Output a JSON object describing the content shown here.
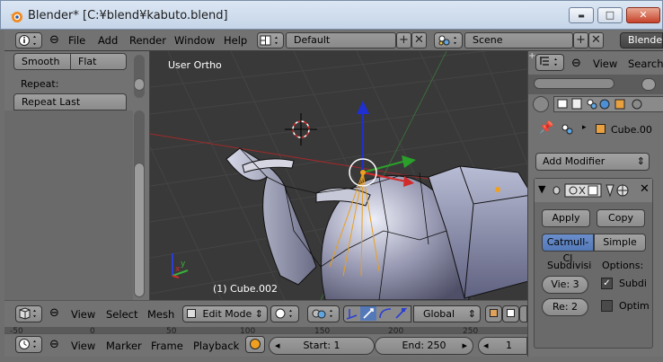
{
  "window": {
    "title": "Blender* [C:¥blend¥kabuto.blend]",
    "minimize_glyph": "▬",
    "maximize_glyph": "□",
    "close_glyph": "✕"
  },
  "top_menu": {
    "info_icon": "info-icon",
    "items": [
      "File",
      "Add",
      "Render",
      "Window",
      "Help"
    ],
    "layout_name": "Default",
    "scene_name": "Scene",
    "engine_label": "Blende"
  },
  "tool_panel": {
    "smooth_label": "Smooth",
    "flat_label": "Flat",
    "repeat_heading": "Repeat:",
    "repeat_last_label": "Repeat Last"
  },
  "viewport": {
    "view_label": "User Ortho",
    "object_label": "(1) Cube.002",
    "axis_x": "x",
    "axis_y": "y"
  },
  "view_header": {
    "menus": [
      "View",
      "Select",
      "Mesh"
    ],
    "mode": "Edit Mode",
    "orientation": "Global",
    "ruler_numbers": [
      "-50",
      "0",
      "50",
      "100",
      "150",
      "200",
      "250"
    ]
  },
  "timeline": {
    "menus": [
      "View",
      "Marker",
      "Frame",
      "Playback"
    ],
    "start_label": "Start: 1",
    "end_label": "End: 250",
    "current_frame": "1"
  },
  "properties": {
    "header_menus": [
      "View",
      "Search"
    ],
    "object_name": "Cube.00",
    "add_modifier_label": "Add Modifier",
    "apply_label": "Apply",
    "copy_label": "Copy",
    "catmull_label": "Catmull-Cl",
    "simple_label": "Simple",
    "subdivisions_heading": "Subdivisi",
    "options_heading": "Options:",
    "view_levels": "Vie: 3",
    "render_levels": "Re: 2",
    "subdiv_uv_label": "Subdi",
    "optimal_label": "Optim",
    "subdiv_uv_checked": true,
    "optimal_checked": false
  },
  "colors": {
    "blender_bg": "#727272",
    "viewport_bg": "#393939",
    "accent_blue": "#5479b8",
    "x_axis": "#d22a2a",
    "y_axis": "#3ab03a",
    "z_axis": "#2a3ed2"
  }
}
